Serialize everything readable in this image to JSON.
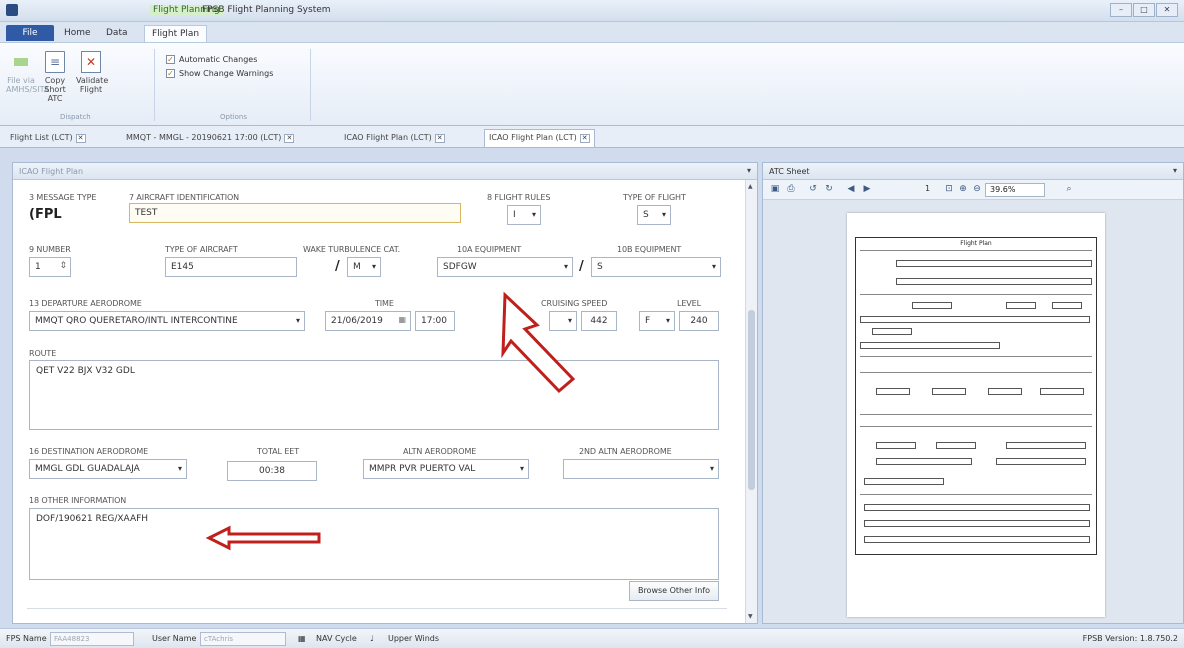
{
  "window": {
    "context_tab": "Flight Planning",
    "title": "FPSB Flight Planning System",
    "controls": [
      "–",
      "□",
      "✕"
    ]
  },
  "ribbon": {
    "file_label": "File",
    "tabs": [
      "Home",
      "Data",
      "Flight Plan"
    ],
    "active_tab": "Flight Plan",
    "buttons": {
      "file_via": "File via AMHS/SITA",
      "copy_short_atc": "Copy Short ATC",
      "validate_flight": "Validate Flight"
    },
    "groups": {
      "dispatch": "Dispatch",
      "options": "Options"
    },
    "options": {
      "automatic_changes": "Automatic Changes",
      "show_change_warnings": "Show Change Warnings"
    }
  },
  "doc_tabs": [
    "Flight List (LCT)",
    "MMQT - MMGL - 20190621 17:00 (LCT)",
    "ICAO Flight Plan (LCT)",
    "ICAO Flight Plan (LCT)"
  ],
  "flight_plan": {
    "pane_title": "ICAO Flight Plan",
    "message_type_label": "3 MESSAGE TYPE",
    "message_type": "(FPL",
    "aircraft_id_label": "7 AIRCRAFT IDENTIFICATION",
    "aircraft_id": "TEST",
    "flight_rules_label": "8 FLIGHT RULES",
    "flight_rules": "I",
    "type_of_flight_label": "TYPE OF FLIGHT",
    "type_of_flight": "S",
    "number_label": "9 NUMBER",
    "number": "1",
    "aircraft_type_label": "TYPE OF AIRCRAFT",
    "aircraft_type": "E145",
    "wake_label": "WAKE TURBULENCE CAT.",
    "wake": "M",
    "equip_a_label": "10A EQUIPMENT",
    "equip_a": "SDFGW",
    "equip_b_label": "10B EQUIPMENT",
    "equip_b": "S",
    "departure_label": "13 DEPARTURE AERODROME",
    "departure": "MMQT QRO QUERETARO/INTL INTERCONTINE",
    "time_label": "TIME",
    "date": "21/06/2019",
    "time": "17:00",
    "cruising_speed_label": "CRUISING SPEED",
    "speed": "442",
    "level_label": "LEVEL",
    "level_unit": "F",
    "level": "240",
    "route_label": "ROUTE",
    "route": "QET V22 BJX V32 GDL",
    "destination_label": "16 DESTINATION AERODROME",
    "destination": "MMGL GDL GUADALAJA",
    "total_eet_label": "TOTAL EET",
    "total_eet": "00:38",
    "altn_label": "ALTN AERODROME",
    "altn": "MMPR PVR PUERTO VAL",
    "altn2_label": "2ND ALTN AERODROME",
    "altn2": "",
    "other_info_label": "18 OTHER INFORMATION",
    "other_info": "DOF/190621 REG/XAAFH",
    "browse_label": "Browse Other Info"
  },
  "atc_sheet": {
    "pane_title": "ATC Sheet",
    "page": "1",
    "zoom": "39.6%",
    "sheet_title": "Flight Plan"
  },
  "status_bar": {
    "fps_name_label": "FPS Name",
    "fps_name": "FAA48823",
    "user_name_label": "User Name",
    "user_name": "cTAchris",
    "nav_cycle": "NAV Cycle",
    "upper_winds": "Upper Winds",
    "version": "FPSB Version: 1.8.750.2"
  },
  "colors": {
    "annotation_arrow": "#c0201b",
    "file_button": "#2f5ba6",
    "highlight_field": "#d8b85e"
  }
}
